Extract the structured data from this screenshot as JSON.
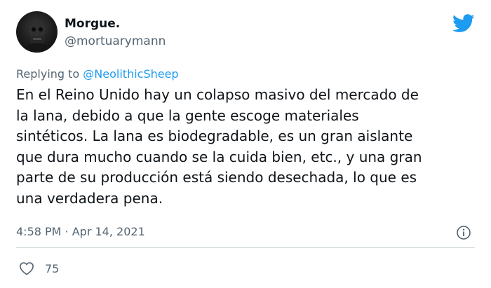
{
  "author": {
    "display_name": "Morgue.",
    "handle": "@mortuarymann",
    "avatar_icon": "skull-portrait-avatar"
  },
  "brand": {
    "icon": "twitter-bird-icon",
    "color": "#1d9bf0"
  },
  "reply": {
    "prefix": "Replying to ",
    "mention": "@NeolithicSheep"
  },
  "tweet": {
    "lines": [
      "En el Reino Unido hay un colapso masivo del mercado de",
      "la lana, debido a que la gente escoge materiales",
      "sintéticos. La lana es biodegradable, es un gran aislante",
      "que dura mucho cuando se la cuida bien, etc., y una gran",
      "parte de su producción está siendo desechada, lo que es",
      "una verdadera pena."
    ]
  },
  "meta": {
    "timestamp": "4:58 PM · Apr 14, 2021",
    "info_icon": "info-icon"
  },
  "actions": {
    "like_icon": "heart-icon",
    "like_count": "75"
  },
  "colors": {
    "text": "#0f1419",
    "secondary": "#536471",
    "link": "#1d9bf0",
    "divider": "#cfd9de"
  }
}
